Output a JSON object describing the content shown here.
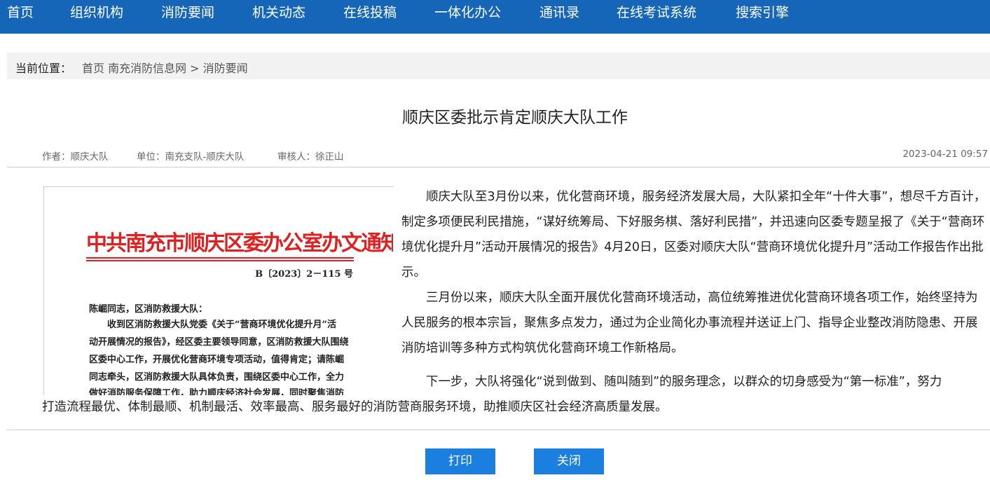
{
  "nav": {
    "items": [
      "首页",
      "组织机构",
      "消防要闻",
      "机关动态",
      "在线投稿",
      "一体化办公",
      "通讯录",
      "在线考试系统",
      "搜索引擎"
    ]
  },
  "breadcrumb": {
    "label": "当前位置：",
    "path": "首页 南充消防信息网 > 消防要闻"
  },
  "article": {
    "title": "顺庆区委批示肯定顺庆大队工作",
    "author": "作者：顺庆大队",
    "unit": "单位：南充支队-顺庆大队",
    "reviewer": "审核人：徐正山",
    "datetime": "2023-04-21 09:57",
    "paragraphs": [
      "顺庆大队至3月份以来，优化营商环境，服务经济发展大局，大队紧扣全年“十件大事”，想尽千方百计，制定多项便民利民措施，“谋好统筹局、下好服务棋、落好利民措”，并迅速向区委专题呈报了《关于“营商环境优化提升月”活动开展情况的报告》4月20日，区委对顺庆大队“营商环境优化提升月”活动工作报告作出批示。",
      "三月份以来，顺庆大队全面开展优化营商环境活动，高位统筹推进优化营商环境各项工作，始终坚持为人民服务的根本宗旨，聚焦多点发力，通过为企业简化办事流程并送证上门、指导企业整改消防隐患、开展消防培训等多种方式构筑优化营商环境工作新格局。",
      "下一步，大队将强化“说到做到、随叫随到”的服务理念，以群众的切身感受为“第一标准”，努力",
      "打造流程最优、体制最顺、机制最活、效率最高、服务最好的消防营商服务环境，助推顺庆区社会经济高质量发展。"
    ]
  },
  "document_image": {
    "header": "中共南充市顺庆区委办公室办文通知",
    "number": "B〔2023〕2－115 号",
    "lines": [
      "陈崛同志，区消防救援大队：",
      "　　收到区消防救援大队党委《关于“营商环境优化提升月”活",
      "动开展情况的报告》，经区委主要领导同意，区消防救援大队围绕",
      "区委中心工作，开展优化营商环境专项活动，值得肯定；请陈崛",
      "同志牵头，区消防救援大队具体负责，围绕区委中心工作，全力",
      "做好消防服务保障工作，助力顺庆经济社会发展，同时聚焦消防"
    ]
  },
  "buttons": {
    "print": "打印",
    "close": "关闭"
  },
  "colors": {
    "nav_bg": "#1565b8",
    "button_bg": "#1b7fe0",
    "doc_red": "#e02020"
  }
}
